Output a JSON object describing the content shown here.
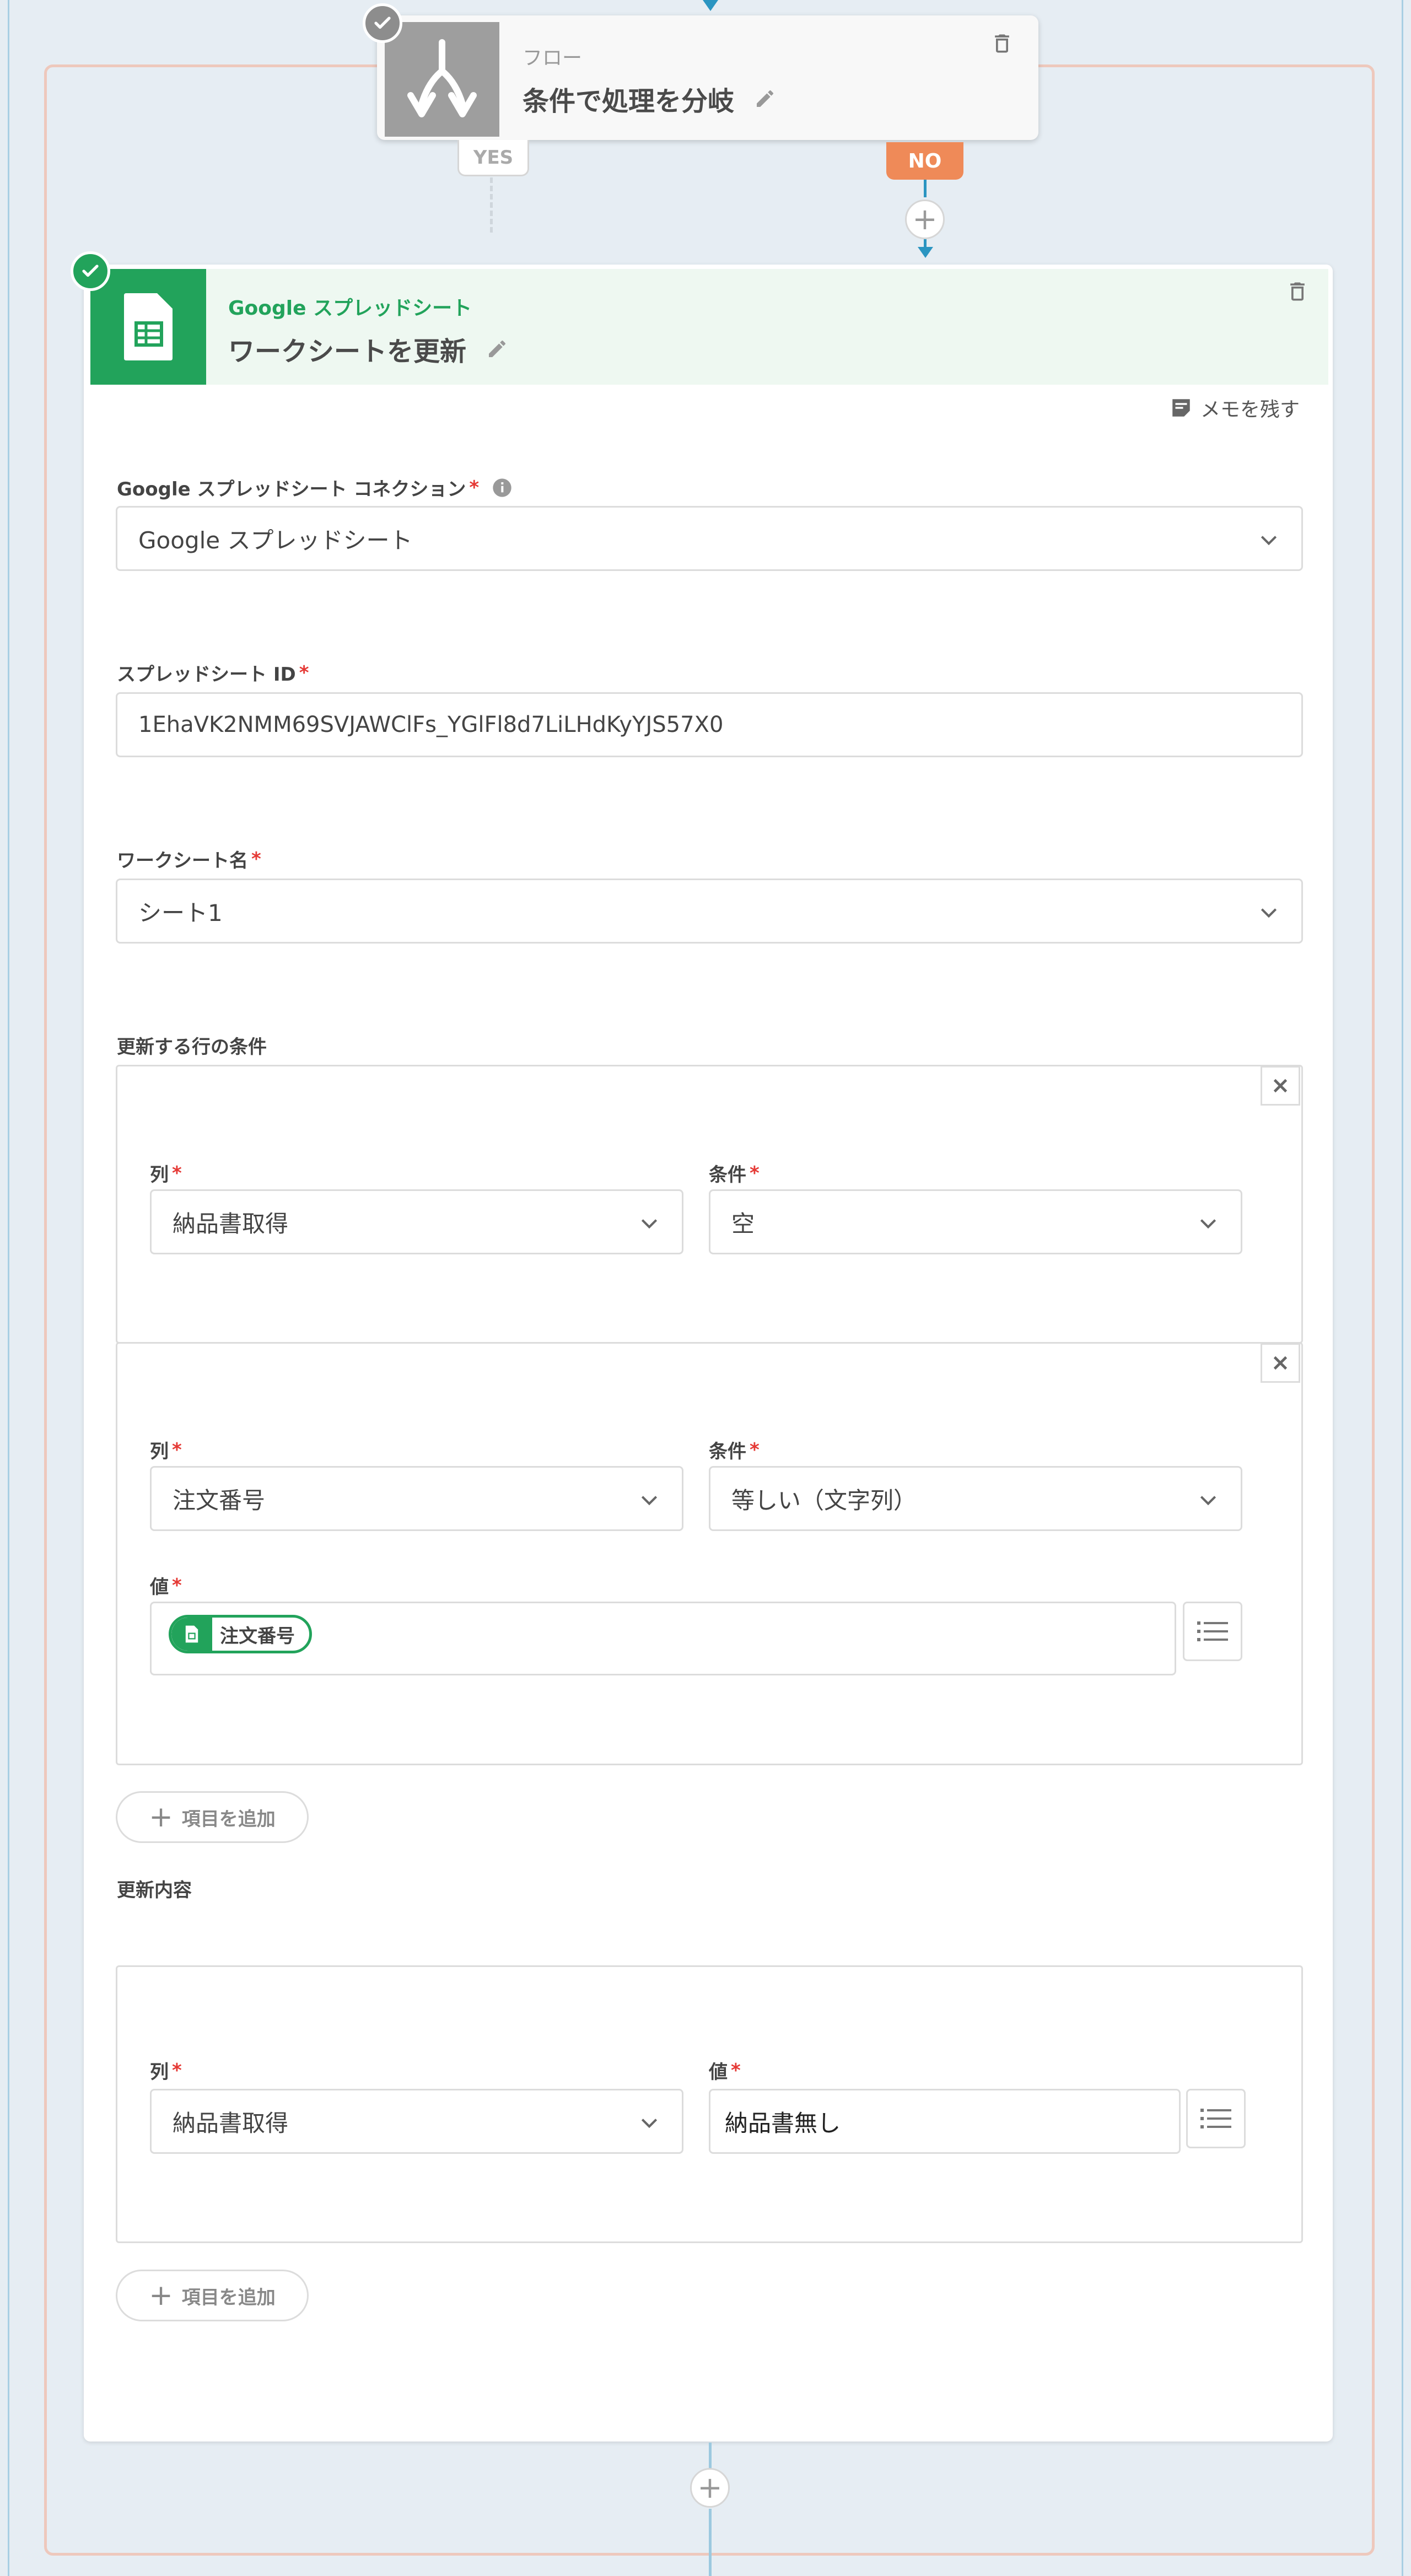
{
  "flow_node": {
    "subtitle": "フロー",
    "title": "条件で処理を分岐",
    "yes_label": "YES",
    "no_label": "NO"
  },
  "sheet_node": {
    "subtitle": "Google スプレッドシート",
    "title": "ワークシートを更新",
    "memo_label": "メモを残す"
  },
  "connection": {
    "label": "Google スプレッドシート コネクション",
    "required": "*",
    "value": "Google スプレッドシート"
  },
  "spreadsheet_id": {
    "label": "スプレッドシート ID",
    "required": "*",
    "value": "1EhaVK2NMM69SVJAWClFs_YGlFl8d7LiLHdKyYJS57X0"
  },
  "worksheet": {
    "label": "ワークシート名",
    "required": "*",
    "value": "シート1"
  },
  "row_conditions": {
    "label": "更新する行の条件",
    "column_label": "列",
    "condition_label": "条件",
    "value_label": "値",
    "required": "*",
    "items": [
      {
        "column": "納品書取得",
        "condition": "空"
      },
      {
        "column": "注文番号",
        "condition": "等しい（文字列）",
        "value_pill": "注文番号"
      }
    ],
    "add_label": "項目を追加"
  },
  "update_content": {
    "label": "更新内容",
    "column_label": "列",
    "value_label": "値",
    "required": "*",
    "column": "納品書取得",
    "value": "納品書無し",
    "add_label": "項目を追加"
  },
  "colors": {
    "accent_green": "#22a35b",
    "flow_blue": "#2b95c1",
    "no_orange": "#ef8a58",
    "required_red": "#e53935"
  }
}
